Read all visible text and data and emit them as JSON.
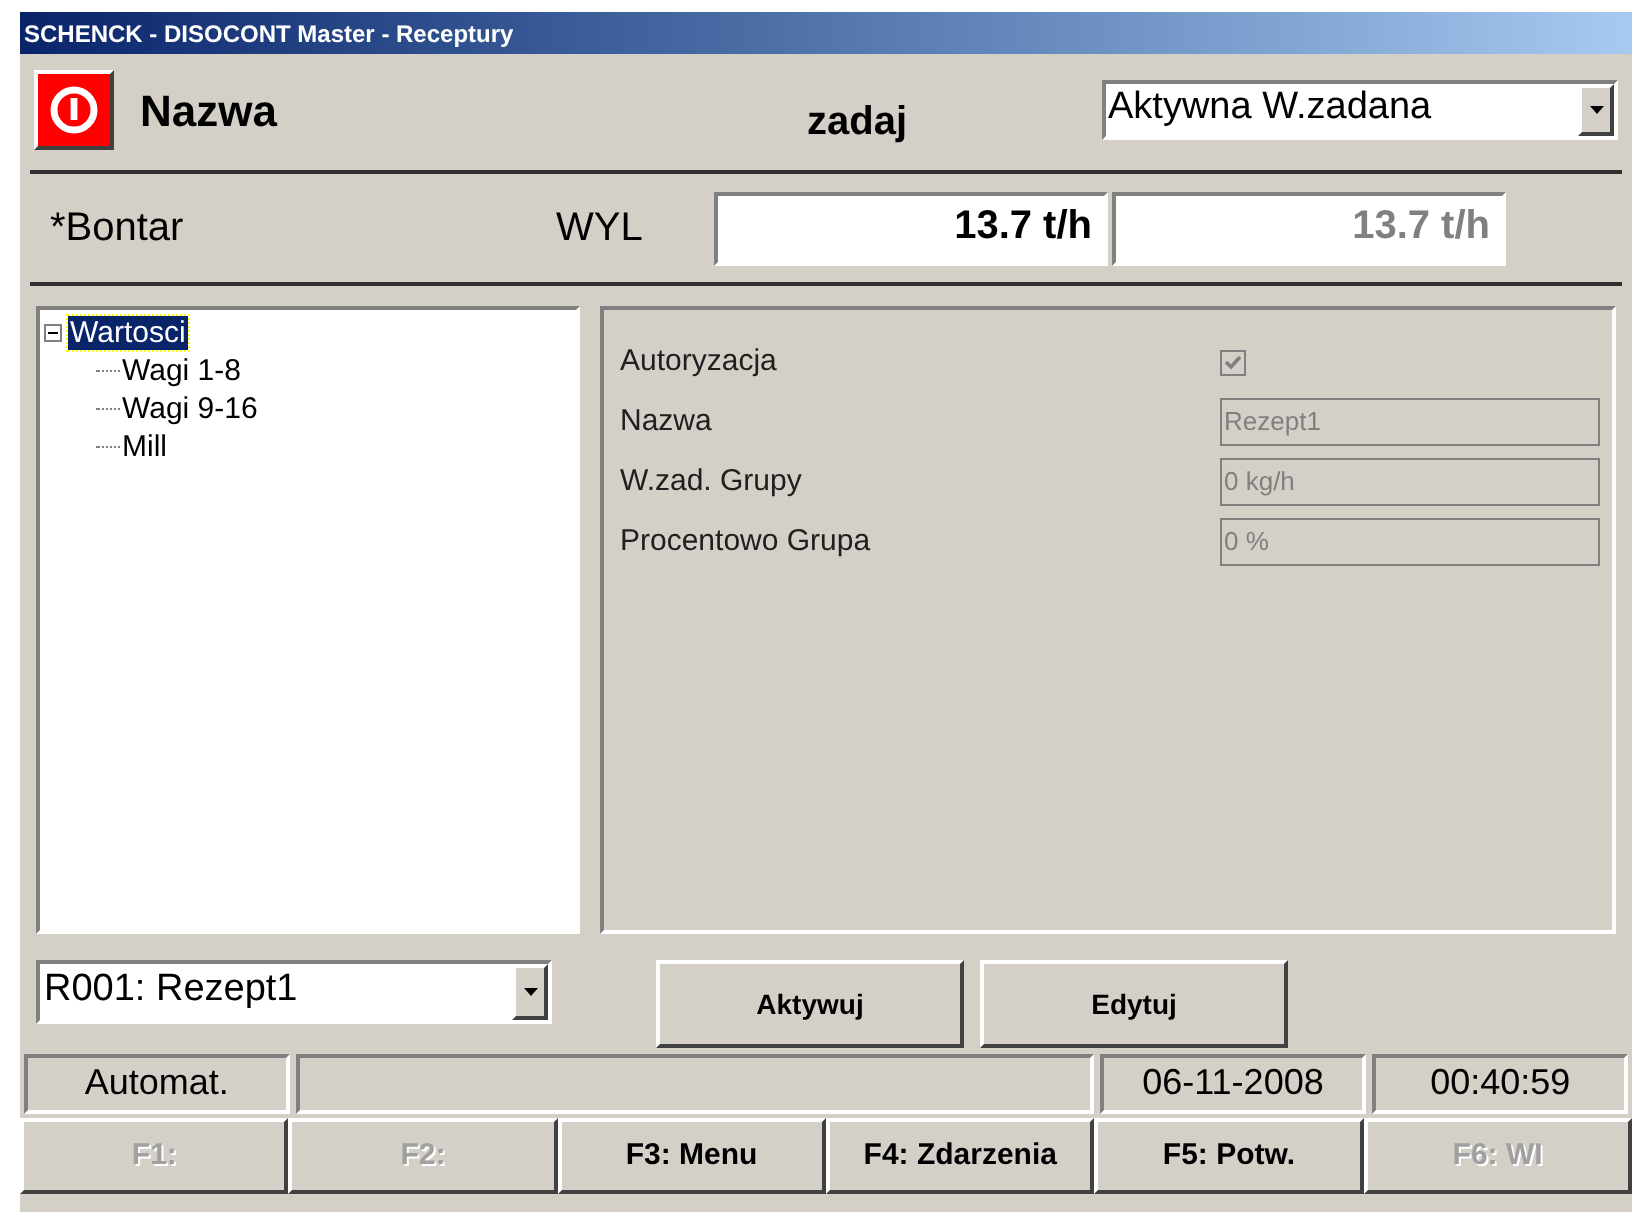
{
  "window": {
    "title": "SCHENCK - DISOCONT Master - Receptury"
  },
  "header": {
    "name_label": "Nazwa",
    "setpoint_label": "zadaj",
    "mode_select": {
      "value": "Aktywna W.zadana"
    }
  },
  "feeder": {
    "name": "*Bontar",
    "output_label": "WYL",
    "setpoint": {
      "value": "13.7 t/h",
      "disabled": false
    },
    "actual": {
      "value": "13.7 t/h",
      "disabled": true
    }
  },
  "tree": [
    {
      "label": "Wartosci",
      "selected": true,
      "expanded": true,
      "children": [
        {
          "label": "Wagi 1-8",
          "selected": false
        },
        {
          "label": "Wagi 9-16",
          "selected": false
        },
        {
          "label": "Mill",
          "selected": false
        }
      ]
    }
  ],
  "properties": [
    {
      "kind": "checkbox",
      "label": "Autoryzacja",
      "checked": true,
      "disabled": true
    },
    {
      "kind": "field",
      "label": "Nazwa",
      "value": "Rezept1",
      "disabled": true
    },
    {
      "kind": "field",
      "label": "W.zad. Grupy",
      "value": "0 kg/h",
      "disabled": true
    },
    {
      "kind": "field",
      "label": "Procentowo Grupa",
      "value": "0 %",
      "disabled": true
    }
  ],
  "recipe_select": {
    "value": "R001: Rezept1"
  },
  "buttons": [
    {
      "label": "Aktywuj"
    },
    {
      "label": "Edytuj"
    }
  ],
  "status_bar": {
    "mode": "Automat.",
    "date": "06-11-2008",
    "time": "00:40:59"
  },
  "function_keys": [
    {
      "label": "F1:",
      "disabled": true
    },
    {
      "label": "F2:",
      "disabled": true
    },
    {
      "label": "F3: Menu",
      "disabled": false
    },
    {
      "label": "F4: Zdarzenia",
      "disabled": false
    },
    {
      "label": "F5: Potw.",
      "disabled": false
    },
    {
      "label": "F6: WI",
      "disabled": true
    }
  ]
}
